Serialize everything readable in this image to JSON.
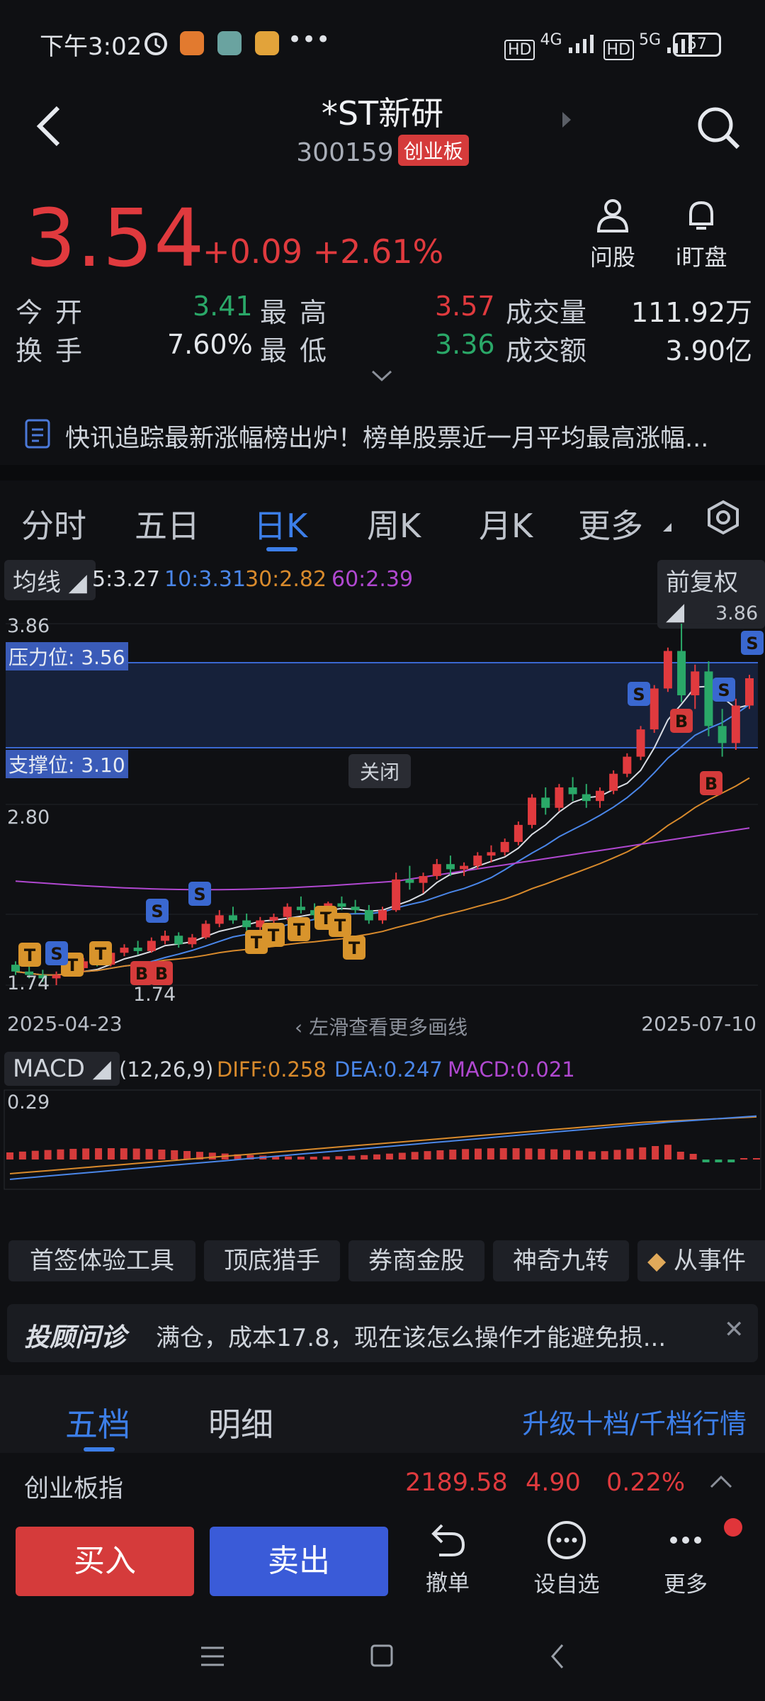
{
  "status_bar": {
    "time": "下午3:02",
    "signal1": "4G",
    "signal2": "5G",
    "battery": "57"
  },
  "header": {
    "title": "*ST新研",
    "code": "300159",
    "board_tag": "创业板"
  },
  "quote": {
    "price": "3.54",
    "change": "+0.09",
    "change_pct": "+2.61%",
    "ask_label": "问股",
    "watch_label": "i盯盘",
    "open_label": "今开",
    "open": "3.41",
    "high_label": "最高",
    "high": "3.57",
    "volume_label": "成交量",
    "volume": "111.92万",
    "turnover_label": "换手",
    "turnover": "7.60%",
    "low_label": "最低",
    "low": "3.36",
    "amount_label": "成交额",
    "amount": "3.90亿"
  },
  "news": {
    "text": "快讯追踪最新涨幅榜出炉！榜单股票近一月平均最高涨幅..."
  },
  "chart_tabs": [
    {
      "label": "分时"
    },
    {
      "label": "五日"
    },
    {
      "label": "日K"
    },
    {
      "label": "周K"
    },
    {
      "label": "月K"
    },
    {
      "label": "更多"
    }
  ],
  "ma_legend": {
    "selector": "均线",
    "ma5": "5:3.27",
    "ma10": "10:3.31",
    "ma30": "30:2.82",
    "ma60": "60:2.39",
    "adjust": "前复权"
  },
  "kline": {
    "top_price": "3.86",
    "resistance": "压力位: 3.56",
    "support": "支撑位: 3.10",
    "close_btn": "关闭",
    "mid_price": "2.80",
    "low_price": "1.74",
    "max_marker": "3.86",
    "min_marker": "1.74",
    "start_date": "2025-04-23",
    "end_date": "2025-07-10",
    "swipe_hint": "左滑查看更多画线"
  },
  "macd": {
    "selector": "MACD",
    "params": "(12,26,9)",
    "diff": "DIFF:0.258",
    "dea": "DEA:0.247",
    "macd": "MACD:0.021",
    "top": "0.29"
  },
  "chips": [
    {
      "label": "首签体验工具"
    },
    {
      "label": "顶底猎手"
    },
    {
      "label": "券商金股"
    },
    {
      "label": "神奇九转"
    },
    {
      "label": "从事件"
    }
  ],
  "advisor": {
    "brand": "投顾问诊",
    "text": "满仓，成本17.8，现在该怎么操作才能避免损..."
  },
  "levels": {
    "tab1": "五档",
    "tab2": "明细",
    "upgrade": "升级十档/千档行情"
  },
  "index": {
    "name": "创业板指",
    "value": "2189.58",
    "change": "4.90",
    "pct": "0.22%"
  },
  "bottom": {
    "buy": "买入",
    "sell": "卖出",
    "cancel": "撤单",
    "favorite": "设自选",
    "more": "更多"
  },
  "colors": {
    "up": "#e03a3e",
    "down": "#2aa868",
    "accent": "#3c7ee8",
    "buy": "#d53b3b",
    "sell": "#3a5bd8"
  },
  "chart_data": {
    "type": "candlestick",
    "x_start": "2025-04-23",
    "x_end": "2025-07-10",
    "y_labels": [
      "3.86",
      "2.80",
      "1.74"
    ],
    "resistance": 3.56,
    "support": 3.1,
    "ohlc": [
      [
        1.86,
        1.88,
        1.8,
        1.82
      ],
      [
        1.82,
        1.85,
        1.78,
        1.8
      ],
      [
        1.8,
        1.83,
        1.76,
        1.78
      ],
      [
        1.78,
        1.82,
        1.74,
        1.8
      ],
      [
        1.8,
        1.86,
        1.79,
        1.84
      ],
      [
        1.84,
        1.9,
        1.82,
        1.88
      ],
      [
        1.88,
        1.92,
        1.85,
        1.86
      ],
      [
        1.86,
        1.95,
        1.85,
        1.93
      ],
      [
        1.93,
        1.98,
        1.91,
        1.96
      ],
      [
        1.96,
        2.0,
        1.92,
        1.94
      ],
      [
        1.94,
        2.02,
        1.93,
        2.0
      ],
      [
        2.0,
        2.06,
        1.98,
        2.03
      ],
      [
        2.03,
        2.05,
        1.96,
        1.98
      ],
      [
        1.98,
        2.04,
        1.96,
        2.02
      ],
      [
        2.02,
        2.12,
        2.01,
        2.1
      ],
      [
        2.1,
        2.18,
        2.08,
        2.15
      ],
      [
        2.15,
        2.2,
        2.1,
        2.12
      ],
      [
        2.12,
        2.16,
        2.06,
        2.08
      ],
      [
        2.08,
        2.14,
        2.05,
        2.12
      ],
      [
        2.12,
        2.16,
        2.09,
        2.14
      ],
      [
        2.14,
        2.22,
        2.12,
        2.2
      ],
      [
        2.2,
        2.26,
        2.16,
        2.18
      ],
      [
        2.18,
        2.22,
        2.12,
        2.15
      ],
      [
        2.15,
        2.23,
        2.14,
        2.22
      ],
      [
        2.22,
        2.26,
        2.18,
        2.2
      ],
      [
        2.2,
        2.24,
        2.16,
        2.18
      ],
      [
        2.18,
        2.21,
        2.1,
        2.12
      ],
      [
        2.12,
        2.2,
        2.1,
        2.18
      ],
      [
        2.18,
        2.4,
        2.17,
        2.36
      ],
      [
        2.36,
        2.44,
        2.3,
        2.34
      ],
      [
        2.34,
        2.4,
        2.28,
        2.38
      ],
      [
        2.38,
        2.48,
        2.36,
        2.45
      ],
      [
        2.45,
        2.5,
        2.38,
        2.42
      ],
      [
        2.42,
        2.46,
        2.38,
        2.44
      ],
      [
        2.44,
        2.52,
        2.42,
        2.5
      ],
      [
        2.5,
        2.56,
        2.46,
        2.52
      ],
      [
        2.52,
        2.6,
        2.5,
        2.58
      ],
      [
        2.58,
        2.7,
        2.56,
        2.68
      ],
      [
        2.68,
        2.86,
        2.66,
        2.84
      ],
      [
        2.84,
        2.9,
        2.74,
        2.78
      ],
      [
        2.78,
        2.92,
        2.76,
        2.9
      ],
      [
        2.9,
        2.96,
        2.82,
        2.86
      ],
      [
        2.86,
        2.92,
        2.78,
        2.82
      ],
      [
        2.82,
        2.9,
        2.78,
        2.88
      ],
      [
        2.88,
        3.0,
        2.86,
        2.98
      ],
      [
        2.98,
        3.1,
        2.96,
        3.08
      ],
      [
        3.08,
        3.26,
        3.06,
        3.24
      ],
      [
        3.24,
        3.5,
        3.22,
        3.48
      ],
      [
        3.48,
        3.72,
        3.46,
        3.7
      ],
      [
        3.7,
        3.86,
        3.4,
        3.44
      ],
      [
        3.44,
        3.62,
        3.36,
        3.58
      ],
      [
        3.58,
        3.64,
        3.2,
        3.26
      ],
      [
        3.26,
        3.36,
        3.08,
        3.16
      ],
      [
        3.16,
        3.42,
        3.12,
        3.38
      ],
      [
        3.38,
        3.56,
        3.36,
        3.54
      ]
    ],
    "macd_top": 0.29
  }
}
